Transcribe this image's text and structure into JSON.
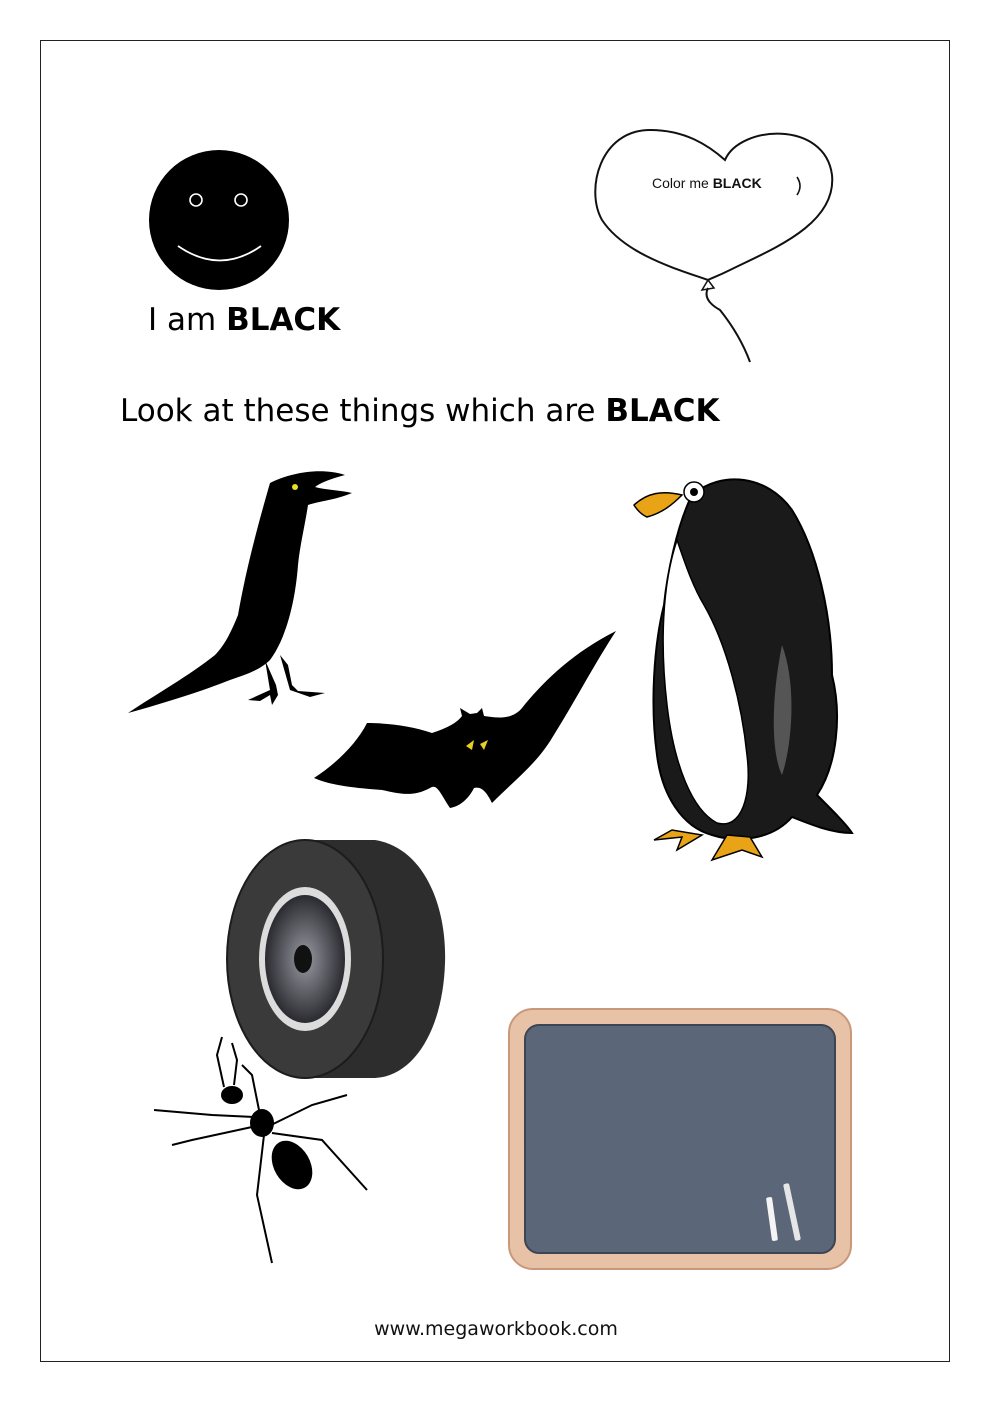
{
  "smiley": {
    "caption_prefix": "I am",
    "caption_strong": "BLACK"
  },
  "balloon": {
    "text_prefix": "Color me",
    "text_strong": "BLACK"
  },
  "heading": {
    "prefix": "Look at these things which are",
    "strong": "BLACK"
  },
  "items": [
    {
      "name": "crow",
      "icon": "crow-icon"
    },
    {
      "name": "bat",
      "icon": "bat-icon"
    },
    {
      "name": "penguin",
      "icon": "penguin-icon"
    },
    {
      "name": "tyre",
      "icon": "tyre-icon"
    },
    {
      "name": "ant",
      "icon": "ant-icon"
    },
    {
      "name": "slate",
      "icon": "slate-icon"
    }
  ],
  "footer": {
    "website": "www.megaworkbook.com"
  },
  "colors": {
    "black": "#000000",
    "slate": "#5b6779",
    "frame_wood": "#e8c2a7",
    "penguin_beak": "#e8a317"
  }
}
